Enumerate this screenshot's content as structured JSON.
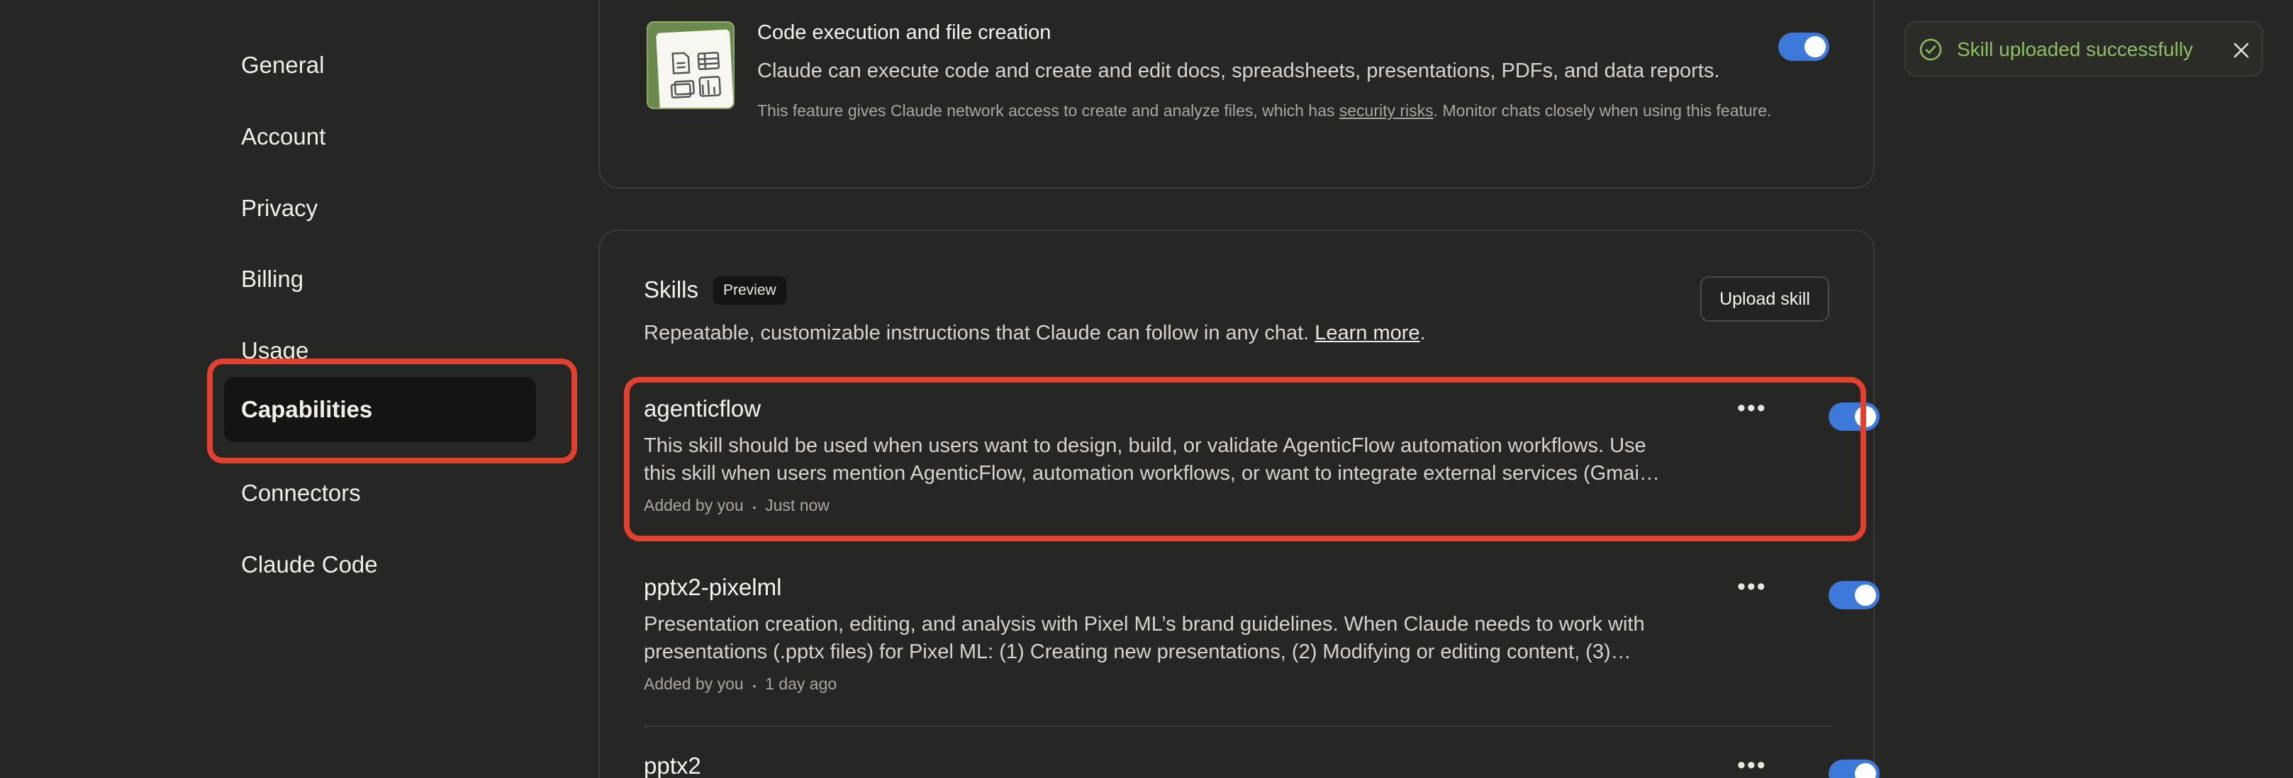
{
  "sidebar": {
    "items": [
      {
        "label": "General"
      },
      {
        "label": "Account"
      },
      {
        "label": "Privacy"
      },
      {
        "label": "Billing"
      },
      {
        "label": "Usage"
      },
      {
        "label": "Capabilities",
        "active": true
      },
      {
        "label": "Connectors"
      },
      {
        "label": "Claude Code"
      }
    ]
  },
  "feature": {
    "title": "Code execution and file creation",
    "description": "Claude can execute code and create and edit docs, spreadsheets, presentations, PDFs, and data reports.",
    "note_prefix": "This feature gives Claude network access to create and analyze files, which has ",
    "note_link": "security risks",
    "note_suffix": ". Monitor chats closely when using this feature.",
    "enabled": true
  },
  "skills": {
    "title": "Skills",
    "badge": "Preview",
    "upload_label": "Upload skill",
    "description": "Repeatable, customizable instructions that Claude can follow in any chat. ",
    "learn_more": "Learn more",
    "period": ".",
    "items": [
      {
        "name": "agenticflow",
        "description_line1": "This skill should be used when users want to design, build, or validate AgenticFlow automation workflows. Use",
        "description_line2": "this skill when users mention AgenticFlow, automation workflows, or want to integrate external services (Gmai…",
        "added_by": "Added by you",
        "time": "Just now",
        "enabled": true
      },
      {
        "name": "pptx2-pixelml",
        "description_line1": "Presentation creation, editing, and analysis with Pixel ML’s brand guidelines. When Claude needs to work with",
        "description_line2": "presentations (.pptx files) for Pixel ML: (1) Creating new presentations, (2) Modifying or editing content, (3)…",
        "added_by": "Added by you",
        "time": "1 day ago",
        "enabled": true
      },
      {
        "name": "pptx2",
        "enabled": true
      }
    ],
    "meta_separator": "•"
  },
  "toast": {
    "message": "Skill uploaded successfully",
    "icon": "check-circle-icon",
    "close_icon": "close-icon"
  },
  "colors": {
    "background": "#262624",
    "accent_toggle": "#3d79d9",
    "highlight": "#e2412f",
    "success": "#8fbf63"
  }
}
